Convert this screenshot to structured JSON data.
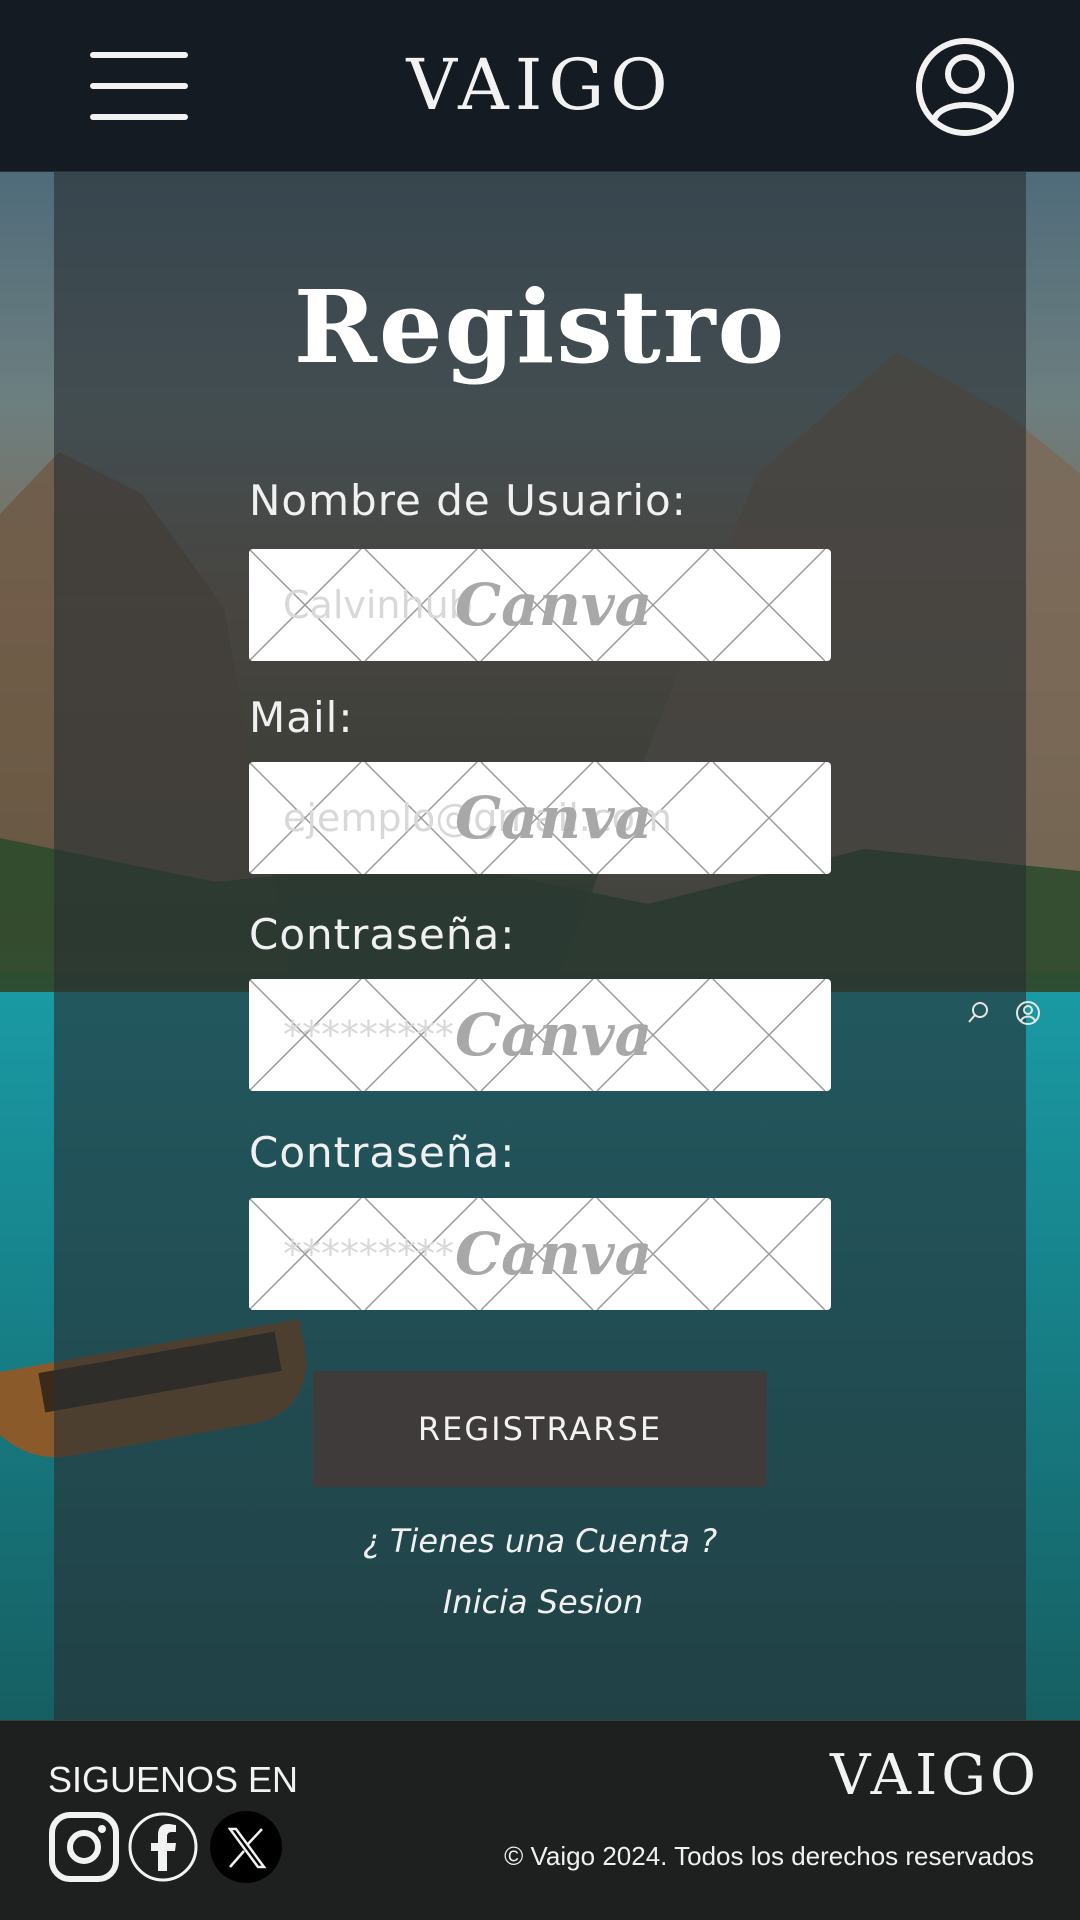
{
  "header": {
    "brand": "VAIGO",
    "menu_icon": "hamburger-menu-icon",
    "user_icon": "user-account-icon"
  },
  "form": {
    "title": "Registro",
    "fields": [
      {
        "label": "Nombre de Usuario:",
        "placeholder": "Calvinhub",
        "type": "text"
      },
      {
        "label": "Mail:",
        "placeholder": "ejemplo@gmail.com",
        "type": "email"
      },
      {
        "label": "Contraseña:",
        "placeholder": "*********",
        "type": "password"
      },
      {
        "label": "Contraseña:",
        "placeholder": "*********",
        "type": "password"
      }
    ],
    "watermark": "Canva",
    "submit_label": "REGISTRARSE",
    "have_account": "¿ Tienes una Cuenta ?",
    "login_link": "Inicia Sesion"
  },
  "side_icons": [
    "search-icon",
    "user-icon"
  ],
  "footer": {
    "follow": "SIGUENOS EN",
    "social": [
      "instagram-icon",
      "facebook-icon",
      "x-icon"
    ],
    "brand": "VAIGO",
    "copyright": "© Vaigo 2024. Todos los derechos reservados"
  },
  "colors": {
    "header_bg": "#151b23",
    "panel_overlay": "#282e34",
    "button_bg": "#3f3b3a",
    "field_bg": "#ffffff",
    "text": "#f2f2f2"
  }
}
